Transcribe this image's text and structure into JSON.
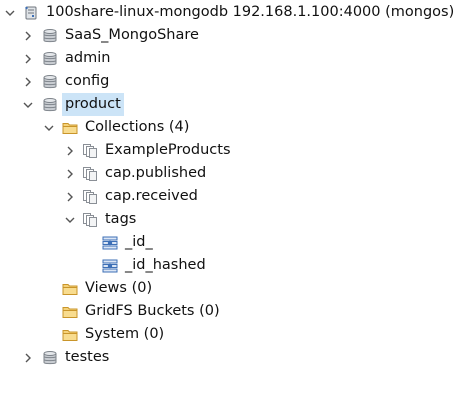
{
  "tree": {
    "root": {
      "label": "100share-linux-mongodb 192.168.1.100:4000 (mongos)",
      "icon": "server-icon"
    },
    "databases": [
      {
        "label": "SaaS_MongoShare",
        "icon": "database-icon",
        "expanded": false
      },
      {
        "label": "admin",
        "icon": "database-icon",
        "expanded": false
      },
      {
        "label": "config",
        "icon": "database-icon",
        "expanded": false
      },
      {
        "label": "product",
        "icon": "database-icon",
        "expanded": true,
        "selected": true,
        "children": {
          "collections_label": "Collections (4)",
          "collections": [
            {
              "label": "ExampleProducts",
              "icon": "collection-icon"
            },
            {
              "label": "cap.published",
              "icon": "collection-icon"
            },
            {
              "label": "cap.received",
              "icon": "collection-icon"
            },
            {
              "label": "tags",
              "icon": "collection-icon",
              "expanded": true,
              "indexes": [
                {
                  "label": "_id_",
                  "icon": "index-icon"
                },
                {
                  "label": "_id_hashed",
                  "icon": "index-icon"
                }
              ]
            }
          ],
          "views_label": "Views (0)",
          "gridfs_label": "GridFS Buckets (0)",
          "system_label": "System (0)"
        }
      },
      {
        "label": "testes",
        "icon": "database-icon",
        "expanded": false
      }
    ]
  },
  "colors": {
    "selection": "#cce4f7",
    "folder": "#e8b84a",
    "database": "#8a8f96",
    "index": "#3d6fb6"
  }
}
